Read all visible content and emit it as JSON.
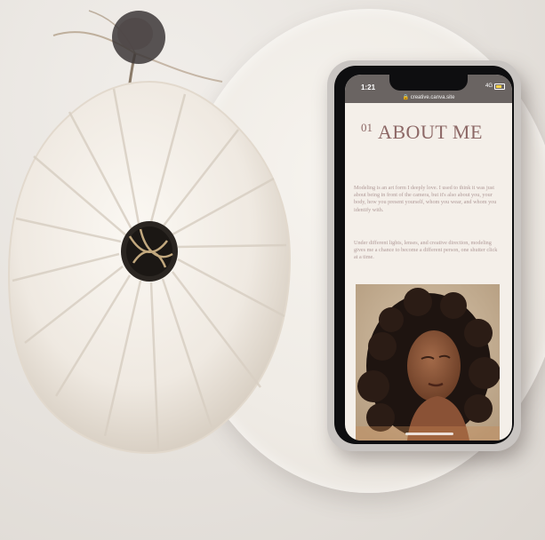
{
  "colors": {
    "accent": "#8d6866",
    "screen_bg": "#f4efe9",
    "status_bar": "#6a6462"
  },
  "phone": {
    "status_time": "1:21",
    "url": "creative.canva.site",
    "signal_text": "4G",
    "page": {
      "section_number": "01",
      "title": "ABOUT ME",
      "paragraph_1": "Modeling is an art form I deeply love. I used to think it was just about being in front of the camera, but it's also about you, your body, how you present yourself, whom you wear, and whom you identify with.",
      "paragraph_2": "Under different lights, lenses, and creative direction, modeling gives me a chance to become a different person, one shutter click at a time."
    }
  }
}
